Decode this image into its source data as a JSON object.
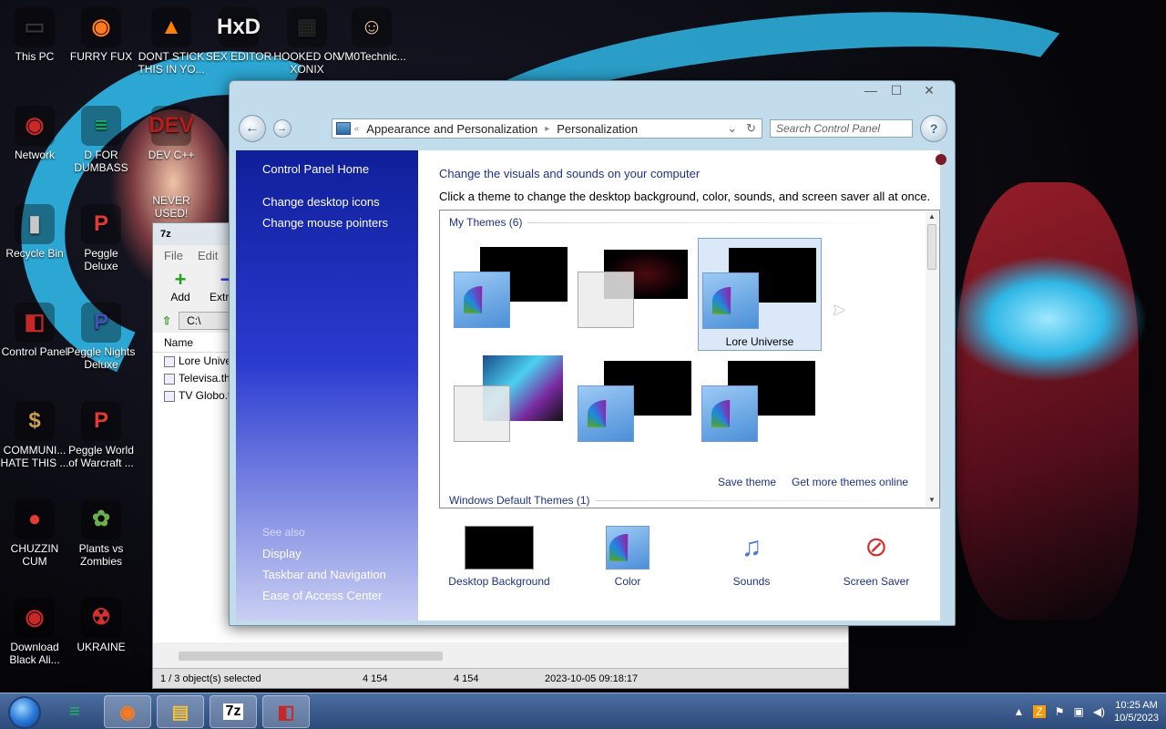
{
  "desktop": {
    "icons": [
      {
        "label": "This PC",
        "glyph": "▭",
        "color": "#333333"
      },
      {
        "label": "FURRY FUX",
        "glyph": "◉",
        "color": "#ff7a1a"
      },
      {
        "label": "DONT STICK THIS IN YO...",
        "glyph": "▲",
        "color": "#ff7f00"
      },
      {
        "label": "SEX EDITOR",
        "glyph": "HxD",
        "color": "#f0f0f0"
      },
      {
        "label": "HOOKED ON XONIX",
        "glyph": "▦",
        "color": "#222222"
      },
      {
        "label": "VM0Technic...",
        "glyph": "☺",
        "color": "#f5d0a0"
      },
      {
        "label": "Network",
        "glyph": "◉",
        "color": "#c82828"
      },
      {
        "label": "D FOR DUMBASS",
        "glyph": "≡",
        "color": "#1db954"
      },
      {
        "label": "Recycle Bin",
        "glyph": "▮",
        "color": "#c8c8c8"
      },
      {
        "label": "Peggle Deluxe",
        "glyph": "P",
        "color": "#e53935"
      },
      {
        "label": "Control Panel",
        "glyph": "◧",
        "color": "#c62828"
      },
      {
        "label": "Peggle Nights Deluxe",
        "glyph": "P",
        "color": "#3f51b5"
      },
      {
        "label": "COMMUNI... HATE THIS ...",
        "glyph": "$",
        "color": "#c9a24a"
      },
      {
        "label": "Peggle World of Warcraft ...",
        "glyph": "P",
        "color": "#e53935"
      },
      {
        "label": "CHUZZIN CUM",
        "glyph": "●",
        "color": "#e53935"
      },
      {
        "label": "Plants vs Zombies",
        "glyph": "✿",
        "color": "#6ab04c"
      },
      {
        "label": "Download Black Ali...",
        "glyph": "◉",
        "color": "#c82828"
      },
      {
        "label": "UKRAINE",
        "glyph": "☢",
        "color": "#d32f2f"
      },
      {
        "label": "DEV C++",
        "glyph": "DEV",
        "color": "#b71c1c"
      },
      {
        "label": "NEVER USED!",
        "glyph": "",
        "color": "transparent"
      }
    ]
  },
  "sevenzip": {
    "title": "7z",
    "menu": [
      "File",
      "Edit"
    ],
    "tools": [
      {
        "label": "Add",
        "glyph": "+",
        "color": "#1ea01e"
      },
      {
        "label": "Extract",
        "glyph": "−",
        "color": "#1e3ce0"
      }
    ],
    "path": "C:\\",
    "column_name": "Name",
    "files": [
      "Lore Unive",
      "Televisa.the",
      "TV Globo.t"
    ],
    "status": {
      "selected": "1 / 3 object(s) selected",
      "size1": "4 154",
      "size2": "4 154",
      "date": "2023-10-05 09:18:17"
    }
  },
  "controlpanel": {
    "window_buttons": {
      "minimize": "—",
      "maximize": "☐",
      "close": "✕"
    },
    "breadcrumb": {
      "overflow": "«",
      "items": [
        "Appearance and Personalization",
        "Personalization"
      ]
    },
    "search_placeholder": "Search Control Panel",
    "left": {
      "links": [
        "Control Panel Home",
        "Change desktop icons",
        "Change mouse pointers"
      ],
      "see_also_header": "See also",
      "see_also": [
        "Display",
        "Taskbar and Navigation",
        "Ease of Access Center"
      ]
    },
    "heading": "Change the visuals and sounds on your computer",
    "subheading": "Click a theme to change the desktop background, color, sounds, and screen saver all at once.",
    "my_themes_header": "My Themes (6)",
    "themes": [
      {
        "label": "",
        "selected": false
      },
      {
        "label": "",
        "selected": false
      },
      {
        "label": "Lore Universe",
        "selected": true
      },
      {
        "label": "",
        "selected": false
      },
      {
        "label": "",
        "selected": false
      },
      {
        "label": "",
        "selected": false
      }
    ],
    "save_theme": "Save theme",
    "get_more": "Get more themes online",
    "default_themes_header": "Windows Default Themes (1)",
    "bottom": {
      "desktop_background": "Desktop Background",
      "color": "Color",
      "sounds": "Sounds",
      "screen_saver": "Screen Saver"
    }
  },
  "taskbar": {
    "buttons": [
      {
        "name": "notepad",
        "glyph": "≡",
        "color": "#1db954"
      },
      {
        "name": "firefox",
        "glyph": "◉",
        "color": "#ff7a1a"
      },
      {
        "name": "explorer",
        "glyph": "▤",
        "color": "#f0c040"
      },
      {
        "name": "7z",
        "glyph": "7z",
        "color": "#000000"
      },
      {
        "name": "control-panel",
        "glyph": "◧",
        "color": "#c62828"
      }
    ],
    "clock_time": "10:25 AM",
    "clock_date": "10/5/2023"
  }
}
